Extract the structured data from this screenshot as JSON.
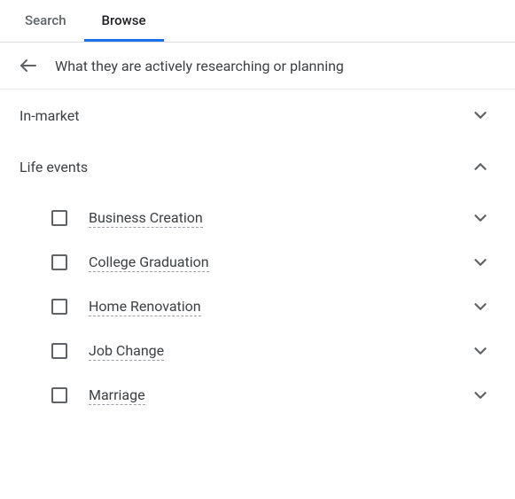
{
  "tabs": {
    "search": "Search",
    "browse": "Browse"
  },
  "header": {
    "title": "What they are actively researching or planning"
  },
  "categories": {
    "in_market": {
      "label": "In-market",
      "expanded": false
    },
    "life_events": {
      "label": "Life events",
      "expanded": true,
      "items": [
        {
          "label": "Business Creation",
          "checked": false
        },
        {
          "label": "College Graduation",
          "checked": false
        },
        {
          "label": "Home Renovation",
          "checked": false
        },
        {
          "label": "Job Change",
          "checked": false
        },
        {
          "label": "Marriage",
          "checked": false
        }
      ]
    }
  }
}
